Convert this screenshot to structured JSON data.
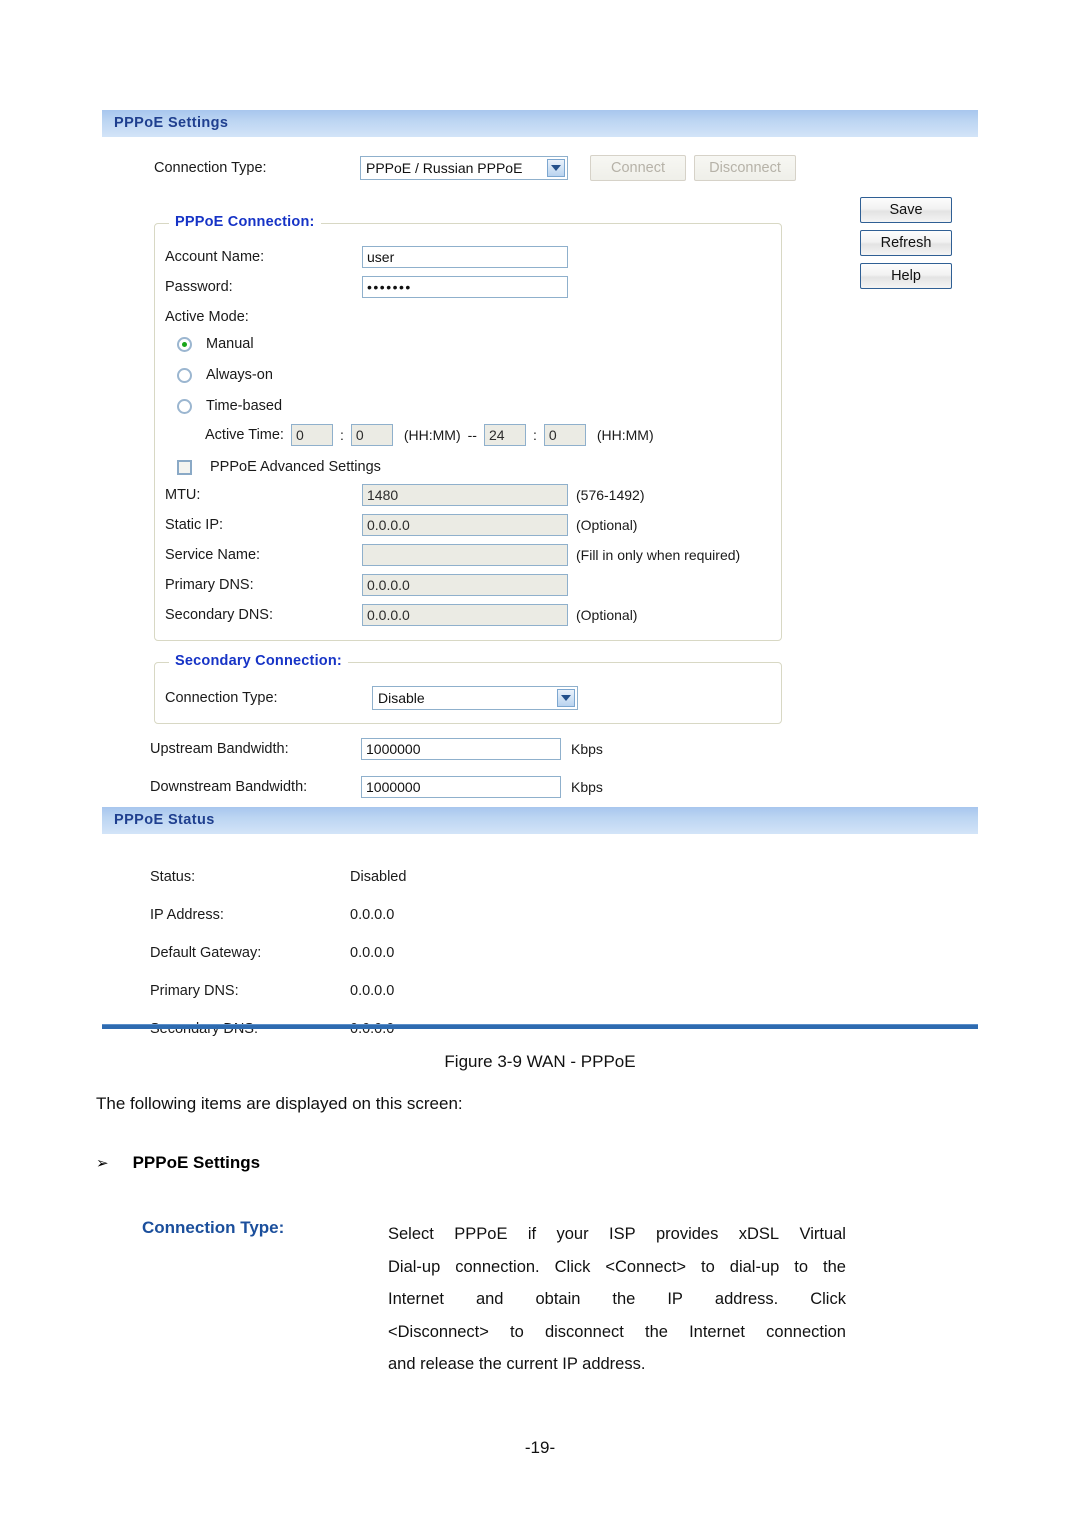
{
  "figure": {
    "settings_panel": {
      "title": "PPPoE Settings",
      "connection_type_label": "Connection Type:",
      "connection_type_value": "PPPoE / Russian PPPoE",
      "connect_button": "Connect",
      "disconnect_button": "Disconnect",
      "pppoe_connection": {
        "legend": "PPPoE Connection:",
        "account_name_label": "Account Name:",
        "account_name_value": "user",
        "password_label": "Password:",
        "password_value": "•••••••",
        "active_mode_label": "Active Mode:",
        "modes": [
          {
            "label": "Manual",
            "selected": true
          },
          {
            "label": "Always-on",
            "selected": false
          },
          {
            "label": "Time-based",
            "selected": false
          }
        ],
        "active_time_label": "Active Time:",
        "active_time_start_hh": "0",
        "active_time_start_mm": "0",
        "active_time_sep_colon": ":",
        "active_time_format_1": "(HH:MM)",
        "active_time_dash": "--",
        "active_time_end_hh": "24",
        "active_time_end_mm": "0",
        "active_time_format_2": "(HH:MM)",
        "advanced_settings_label": "PPPoE Advanced Settings",
        "advanced_settings_checked": false,
        "mtu_label": "MTU:",
        "mtu_value": "1480",
        "mtu_hint": "(576-1492)",
        "static_ip_label": "Static IP:",
        "static_ip_value": "0.0.0.0",
        "static_ip_hint": "(Optional)",
        "service_name_label": "Service Name:",
        "service_name_value": "",
        "service_name_hint": "(Fill in only when required)",
        "primary_dns_label": "Primary DNS:",
        "primary_dns_value": "0.0.0.0",
        "primary_dns_hint": "",
        "secondary_dns_label": "Secondary DNS:",
        "secondary_dns_value": "0.0.0.0",
        "secondary_dns_hint": "(Optional)"
      },
      "secondary_connection": {
        "legend": "Secondary Connection:",
        "connection_type_label": "Connection Type:",
        "connection_type_value": "Disable"
      },
      "upstream_label": "Upstream Bandwidth:",
      "upstream_value": "1000000",
      "upstream_unit": "Kbps",
      "downstream_label": "Downstream Bandwidth:",
      "downstream_value": "1000000",
      "downstream_unit": "Kbps",
      "action_buttons": [
        {
          "label": "Save"
        },
        {
          "label": "Refresh"
        },
        {
          "label": "Help"
        }
      ]
    },
    "status_panel": {
      "title": "PPPoE Status",
      "rows": [
        {
          "label": "Status:",
          "value": "Disabled"
        },
        {
          "label": "IP Address:",
          "value": "0.0.0.0"
        },
        {
          "label": "Default Gateway:",
          "value": "0.0.0.0"
        },
        {
          "label": "Primary DNS:",
          "value": "0.0.0.0"
        },
        {
          "label": "Secondary DNS:",
          "value": "0.0.0.0"
        }
      ]
    }
  },
  "document": {
    "figure_caption": "Figure 3-9 WAN - PPPoE",
    "lead_text": "The following items are displayed on this screen:",
    "bullet_marker": "➢",
    "bullet_text": "PPPoE Settings",
    "term": "Connection Type:",
    "description_lines": [
      "Select PPPoE if your ISP provides xDSL Virtual",
      "Dial-up connection. Click <Connect> to dial-up to the",
      "Internet and obtain the IP address. Click",
      "<Disconnect> to disconnect the Internet connection",
      "and release the current IP address."
    ],
    "page_number": "-19-"
  },
  "colors": {
    "panel_bar_text": "#1f3f8f",
    "legend_text": "#1633c6",
    "term_text": "#1b4f9c",
    "rule": "#2e6bb0",
    "radio_dot": "#1aa61a"
  }
}
